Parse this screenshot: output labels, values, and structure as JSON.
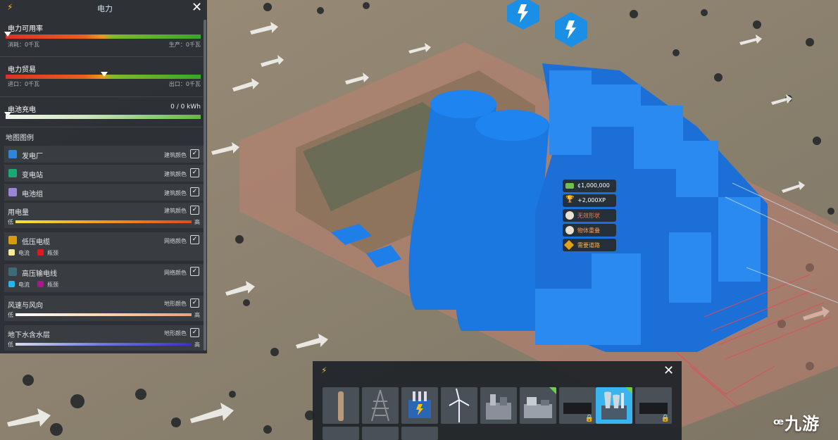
{
  "panel": {
    "title": "电力",
    "close_icon": "close-icon",
    "availability": {
      "label": "电力可用率",
      "consumption": "消耗：0千瓦",
      "production": "生产：0千瓦"
    },
    "trade": {
      "label": "电力贸易",
      "import": "进口：0千瓦",
      "export": "出口：0千瓦"
    },
    "battery": {
      "label": "电池充电",
      "value": "0 / 0 kWh"
    },
    "legend_title": "地图图例",
    "legend": [
      {
        "name": "发电厂",
        "mode": "建筑颜色",
        "color": "#2f86d8"
      },
      {
        "name": "变电站",
        "mode": "建筑颜色",
        "color": "#1aa873"
      },
      {
        "name": "电池组",
        "mode": "建筑颜色",
        "color": "#9b85d8"
      },
      {
        "name": "用电量",
        "mode": "建筑颜色",
        "low": "低",
        "high": "高"
      },
      {
        "name": "低压电缆",
        "mode": "网络颜色",
        "color": "#d79a12",
        "flow": "电流",
        "bottleneck": "瓶颈"
      },
      {
        "name": "高压输电线",
        "mode": "网络颜色",
        "color": "#3d6a78",
        "flow": "电流",
        "bottleneck": "瓶颈"
      },
      {
        "name": "风速与风向",
        "mode": "地形颜色",
        "low": "低",
        "high": "高"
      },
      {
        "name": "地下水含水层",
        "mode": "地形颜色",
        "low": "低",
        "high": "高"
      }
    ]
  },
  "tooltip": {
    "cost": "¢1,000,000",
    "xp": "+2,000XP",
    "warnings": [
      "无效形状",
      "物体重叠",
      "需要道路"
    ]
  },
  "toolbar": {
    "icon": "lightning-icon",
    "close_icon": "close-icon",
    "items": [
      {
        "name": "wooden-pole",
        "locked": false,
        "new": false
      },
      {
        "name": "transmission-tower",
        "locked": false,
        "new": false
      },
      {
        "name": "transformer",
        "locked": false,
        "new": false
      },
      {
        "name": "wind-turbine",
        "locked": false,
        "new": false
      },
      {
        "name": "power-plant-a",
        "locked": false,
        "new": false
      },
      {
        "name": "power-plant-b",
        "locked": false,
        "new": true
      },
      {
        "name": "power-plant-c",
        "locked": true,
        "new": false
      },
      {
        "name": "coal-power-plant",
        "locked": false,
        "new": true,
        "selected": true
      },
      {
        "name": "power-plant-d",
        "locked": true,
        "new": false
      }
    ]
  },
  "watermark": "九游"
}
